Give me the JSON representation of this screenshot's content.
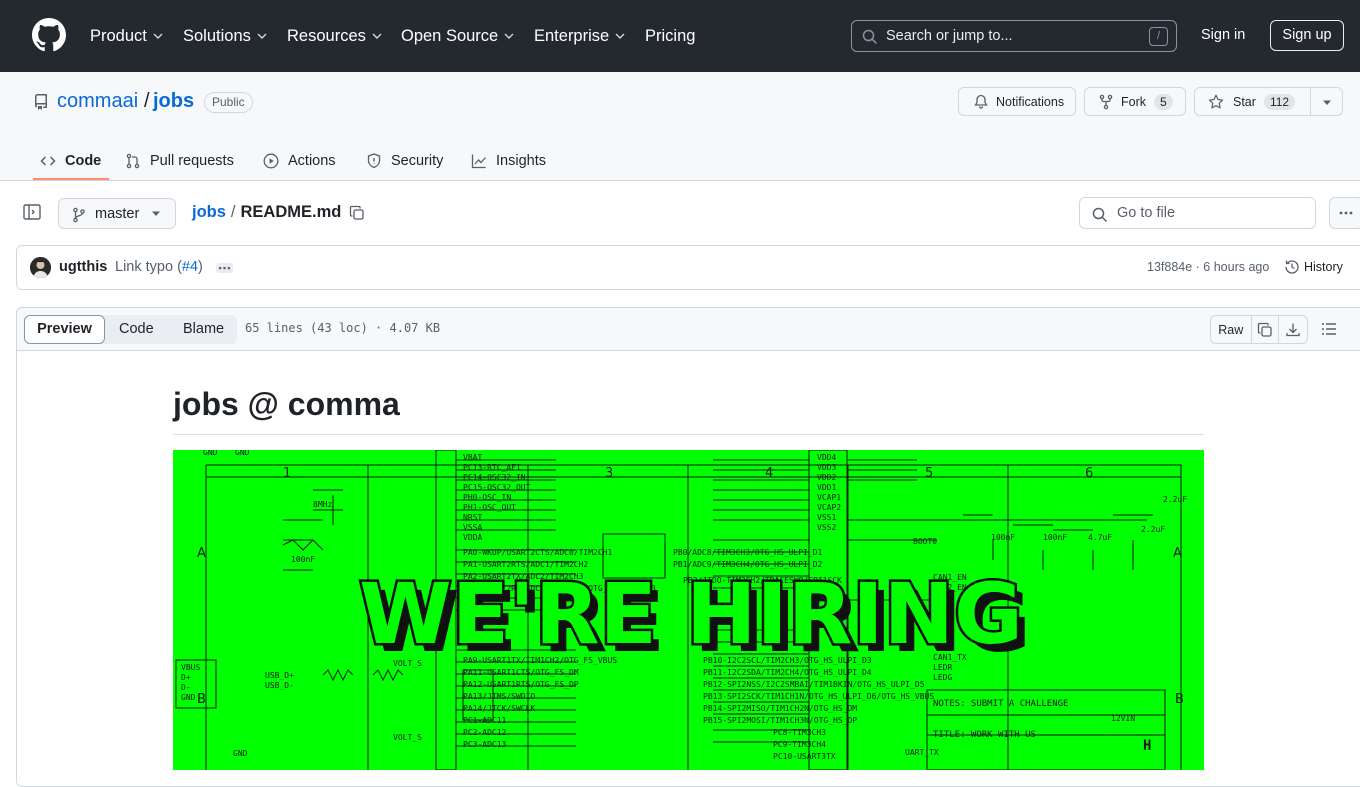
{
  "header": {
    "nav": [
      "Product",
      "Solutions",
      "Resources",
      "Open Source",
      "Enterprise",
      "Pricing"
    ],
    "search_placeholder": "Search or jump to...",
    "search_shortcut": "/",
    "signin": "Sign in",
    "signup": "Sign up"
  },
  "repo": {
    "owner": "commaai",
    "separator": "/",
    "name": "jobs",
    "visibility": "Public",
    "notifications": "Notifications",
    "fork_label": "Fork",
    "fork_count": "5",
    "star_label": "Star",
    "star_count": "112"
  },
  "tabs": [
    "Code",
    "Pull requests",
    "Actions",
    "Security",
    "Insights"
  ],
  "file": {
    "branch": "master",
    "crumb_repo": "jobs",
    "crumb_sep": "/",
    "crumb_file": "README.md",
    "goto_placeholder": "Go to file"
  },
  "commit": {
    "author": "ugtthis",
    "message_prefix": "Link typo (",
    "message_link": "#4",
    "message_suffix": ")",
    "hash_time": "13f884e · 6 hours ago",
    "history": "History"
  },
  "viewer": {
    "modes": [
      "Preview",
      "Code",
      "Blame"
    ],
    "meta": "65 lines (43 loc) · 4.07 KB",
    "raw": "Raw"
  },
  "readme": {
    "title": "jobs @ comma",
    "banner_text": "WE'RE HIRING",
    "schematic_notes": "NOTES: SUBMIT A CHALLENGE",
    "schematic_title": "TITLE: WORK WITH US"
  },
  "colors": {
    "header_bg": "#24292f",
    "link": "#0969da",
    "tab_underline": "#fd8c73",
    "banner_green": "#00ff00"
  }
}
